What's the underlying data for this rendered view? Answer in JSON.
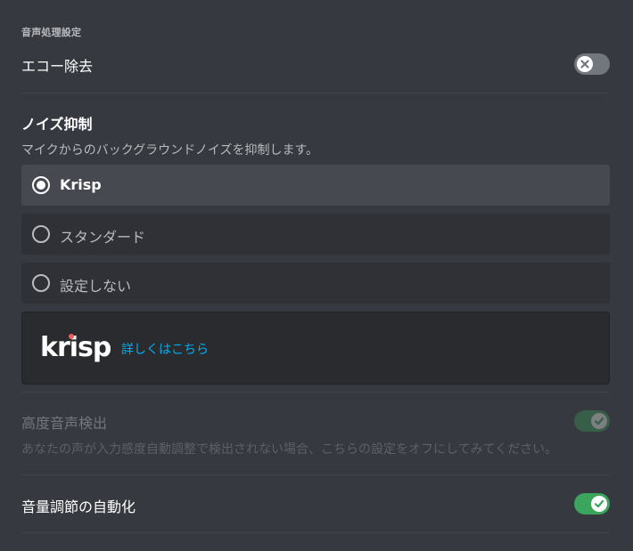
{
  "section": {
    "title": "音声処理設定"
  },
  "echo_cancellation": {
    "label": "エコー除去",
    "enabled": false
  },
  "noise_suppression": {
    "title": "ノイズ抑制",
    "description": "マイクからのバックグラウンドノイズを抑制します。",
    "options": [
      {
        "label": "Krisp",
        "selected": true
      },
      {
        "label": "スタンダード",
        "selected": false
      },
      {
        "label": "設定しない",
        "selected": false
      }
    ]
  },
  "krisp_promo": {
    "logo_text": "krisp",
    "link_text": "詳しくはこちら"
  },
  "advanced_voice_activity": {
    "label": "高度音声検出",
    "description": "あなたの声が入力感度自動調整で検出されない場合、こちらの設定をオフにしてみてください。",
    "enabled": true,
    "disabled": true
  },
  "auto_gain_control": {
    "label": "音量調節の自動化",
    "enabled": true
  },
  "colors": {
    "background": "#36393f",
    "toggle_on": "#3ba55d",
    "toggle_off": "#72767d",
    "link": "#00aff4",
    "krisp_dot": "#f55d5d"
  }
}
